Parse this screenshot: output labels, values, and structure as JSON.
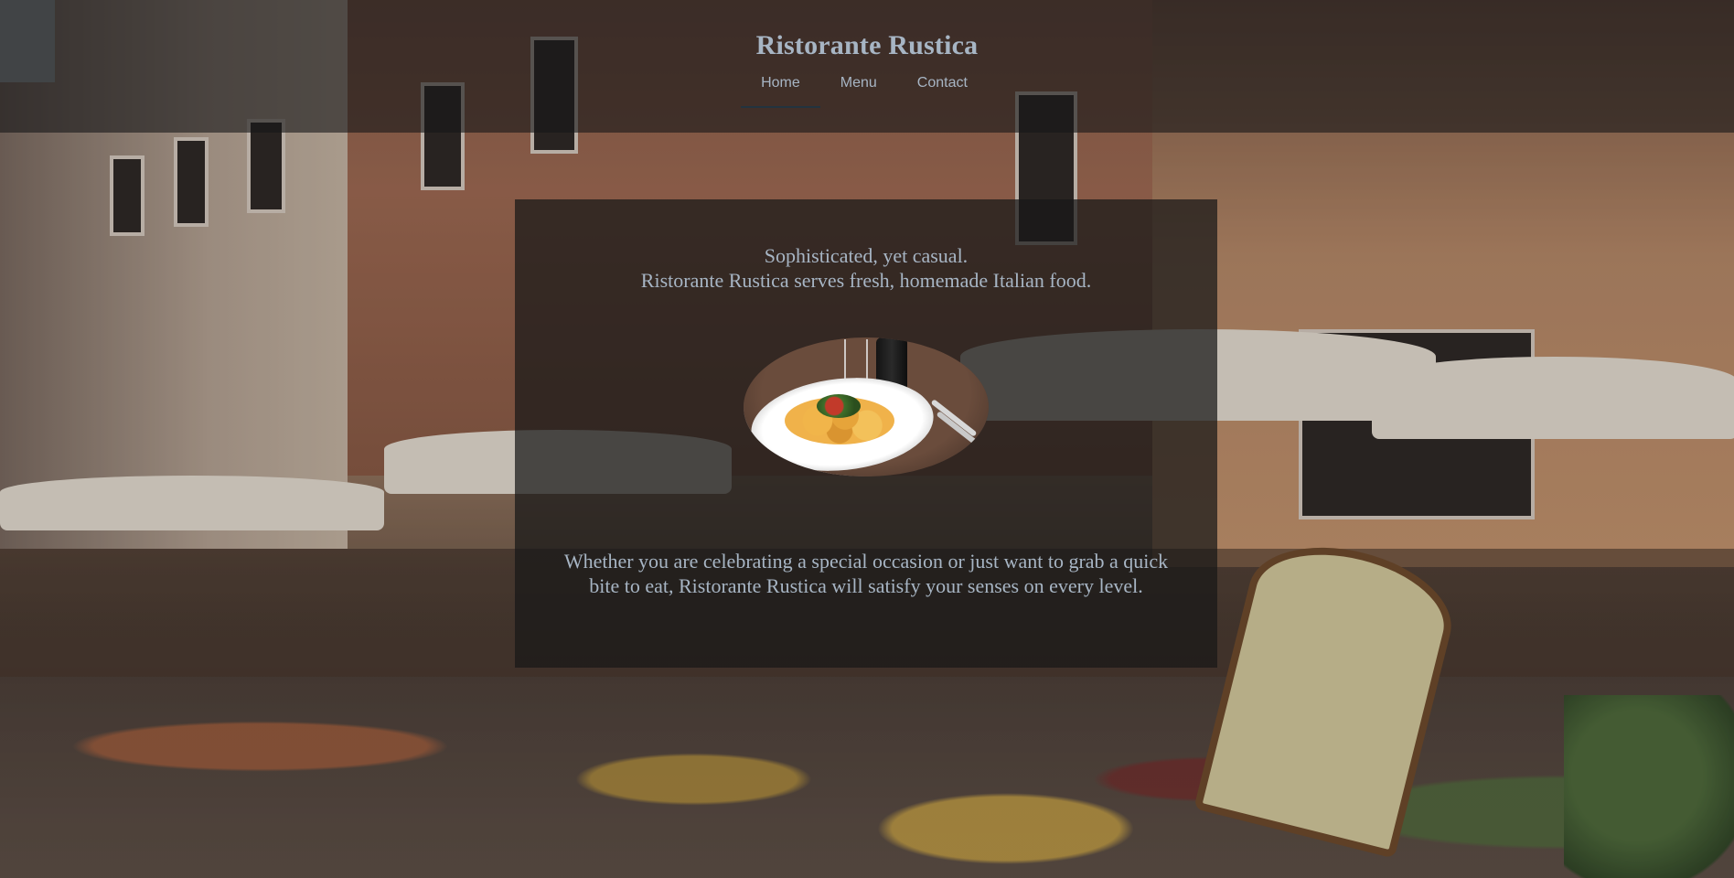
{
  "site": {
    "title": "Ristorante Rustica"
  },
  "nav": {
    "items": [
      {
        "label": "Home",
        "active": true
      },
      {
        "label": "Menu",
        "active": false
      },
      {
        "label": "Contact",
        "active": false
      }
    ]
  },
  "hero": {
    "tagline_line1": "Sophisticated, yet casual.",
    "tagline_line2": "Ristorante Rustica serves fresh, homemade Italian food.",
    "description": "Whether you are celebrating a special occasion or just want to grab a quick bite to eat, Ristorante Rustica will satisfy your senses on every level."
  },
  "colors": {
    "text": "#a7b5c4",
    "header_bg": "rgba(22,22,24,0.6)",
    "panel_bg": "rgba(24,24,24,0.72)",
    "nav_active_underline": "#22333f"
  }
}
